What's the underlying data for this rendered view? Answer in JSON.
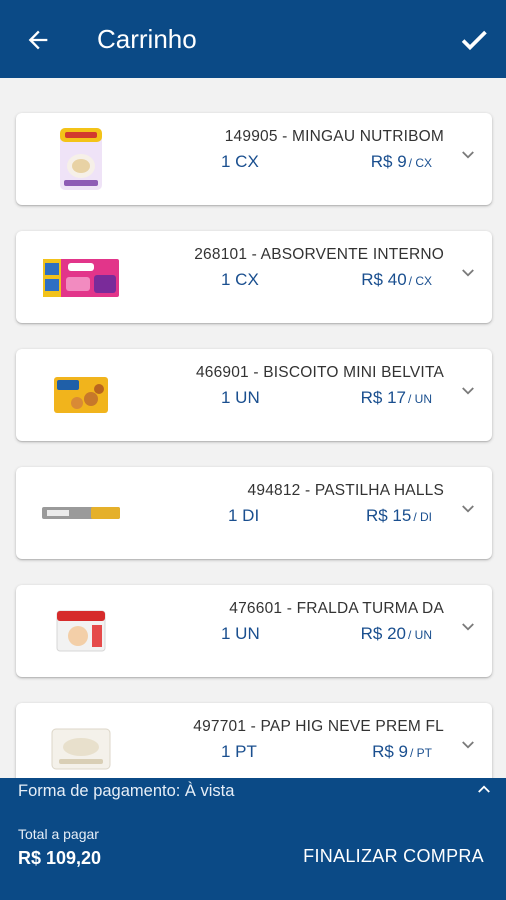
{
  "header": {
    "title": "Carrinho",
    "back_icon": "arrow-left-icon",
    "confirm_icon": "check-icon"
  },
  "cart": {
    "items": [
      {
        "name": "149905 - MINGAU NUTRIBOM",
        "quantity": "1 CX",
        "price": "R$ 9",
        "price_unit": "/ CX"
      },
      {
        "name": "268101 - ABSORVENTE INTERNO",
        "quantity": "1 CX",
        "price": "R$ 40",
        "price_unit": "/ CX"
      },
      {
        "name": "466901 - BISCOITO MINI BELVITA",
        "quantity": "1 UN",
        "price": "R$ 17",
        "price_unit": "/ UN"
      },
      {
        "name": "494812 - PASTILHA HALLS",
        "quantity": "1 DI",
        "price": "R$ 15",
        "price_unit": "/ DI"
      },
      {
        "name": "476601 - FRALDA TURMA DA",
        "quantity": "1 UN",
        "price": "R$ 20",
        "price_unit": "/ UN"
      },
      {
        "name": "497701 - PAP HIG NEVE PREM FL",
        "quantity": "1 PT",
        "price": "R$ 9",
        "price_unit": "/ PT"
      }
    ]
  },
  "footer": {
    "payment_label": "Forma de pagamento: À vista",
    "total_label": "Total a pagar",
    "total_value": "R$ 109,20",
    "finalize_label": "FINALIZAR COMPRA"
  },
  "colors": {
    "primary": "#0b4a86",
    "price_text": "#1a4f8f",
    "card_bg": "#ffffff",
    "page_bg": "#f2f2f2"
  }
}
